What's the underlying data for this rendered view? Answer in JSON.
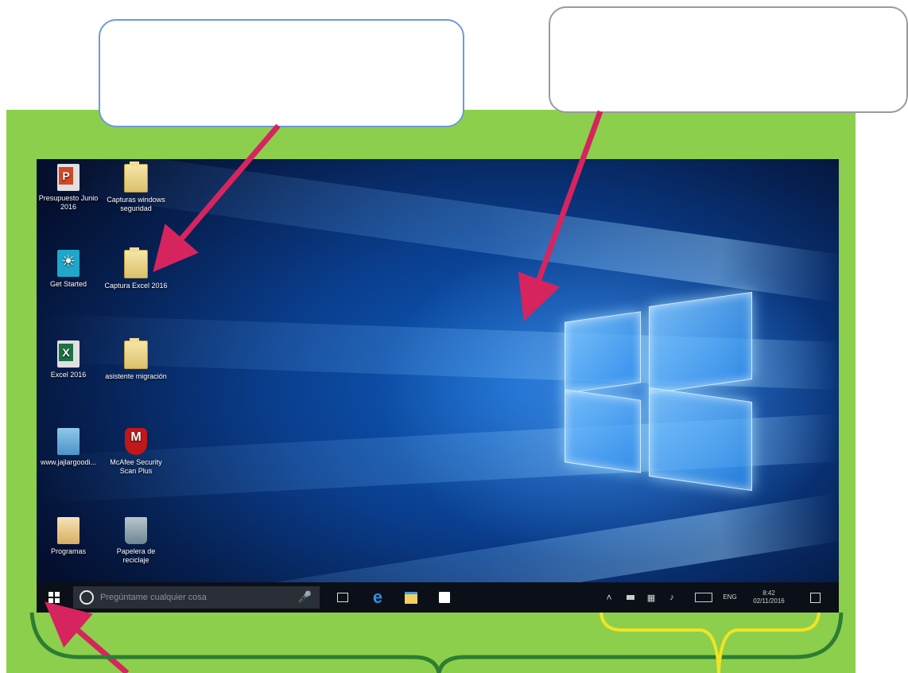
{
  "desktop": {
    "icons": [
      {
        "label": "Presupuesto Junio 2016",
        "kind": "ppt"
      },
      {
        "label": "Capturas windows seguridad",
        "kind": "folder"
      },
      {
        "label": "Get Started",
        "kind": "bulb"
      },
      {
        "label": "Captura Excel 2016",
        "kind": "folder"
      },
      {
        "label": "Excel 2016",
        "kind": "xls"
      },
      {
        "label": "asistente migración",
        "kind": "folder"
      },
      {
        "label": "www.jajlargoodi...",
        "kind": "docs"
      },
      {
        "label": "McAfee Security Scan Plus",
        "kind": "mcafee"
      },
      {
        "label": "Programas",
        "kind": "prog"
      },
      {
        "label": "Papelera de reciclaje",
        "kind": "bin"
      }
    ]
  },
  "taskbar": {
    "search_placeholder": "Pregúntame cualquier cosa",
    "pinned": [
      "task-view-icon",
      "edge-icon",
      "file-explorer-icon",
      "store-icon"
    ],
    "tray": {
      "language": "ENG",
      "time": "8:42",
      "date": "02/11/2016"
    }
  },
  "colors": {
    "frame_green": "#8ccf4d",
    "arrow_magenta": "#d6245f",
    "bracket_green": "#2e7d32",
    "bracket_yellow": "#f2e422",
    "callout_blue": "#6e9bd6",
    "callout_gray": "#9a9a9a"
  }
}
